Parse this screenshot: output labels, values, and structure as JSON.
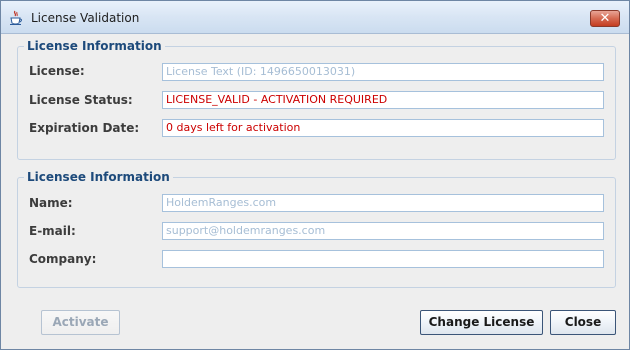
{
  "window": {
    "title": "License Validation",
    "close_symbol": "✕",
    "icon": "java-cup-icon"
  },
  "license_section": {
    "legend": "License Information",
    "fields": [
      {
        "label": "License:",
        "value": "License Text (ID: 1496650013031)"
      },
      {
        "label": "License Status:",
        "value": "LICENSE_VALID - ACTIVATION REQUIRED"
      },
      {
        "label": "Expiration Date:",
        "value": "0 days left for activation"
      }
    ]
  },
  "licensee_section": {
    "legend": "Licensee Information",
    "fields": [
      {
        "label": "Name:",
        "value": "HoldemRanges.com"
      },
      {
        "label": "E-mail:",
        "value": "support@holdemranges.com"
      },
      {
        "label": "Company:",
        "value": ""
      }
    ]
  },
  "buttons": {
    "activate": "Activate",
    "change_license": "Change License",
    "close": "Close"
  },
  "colors": {
    "legend_text": "#1d4a7b",
    "status_red": "#cc0000",
    "disabled_text": "#a6bdd4"
  }
}
